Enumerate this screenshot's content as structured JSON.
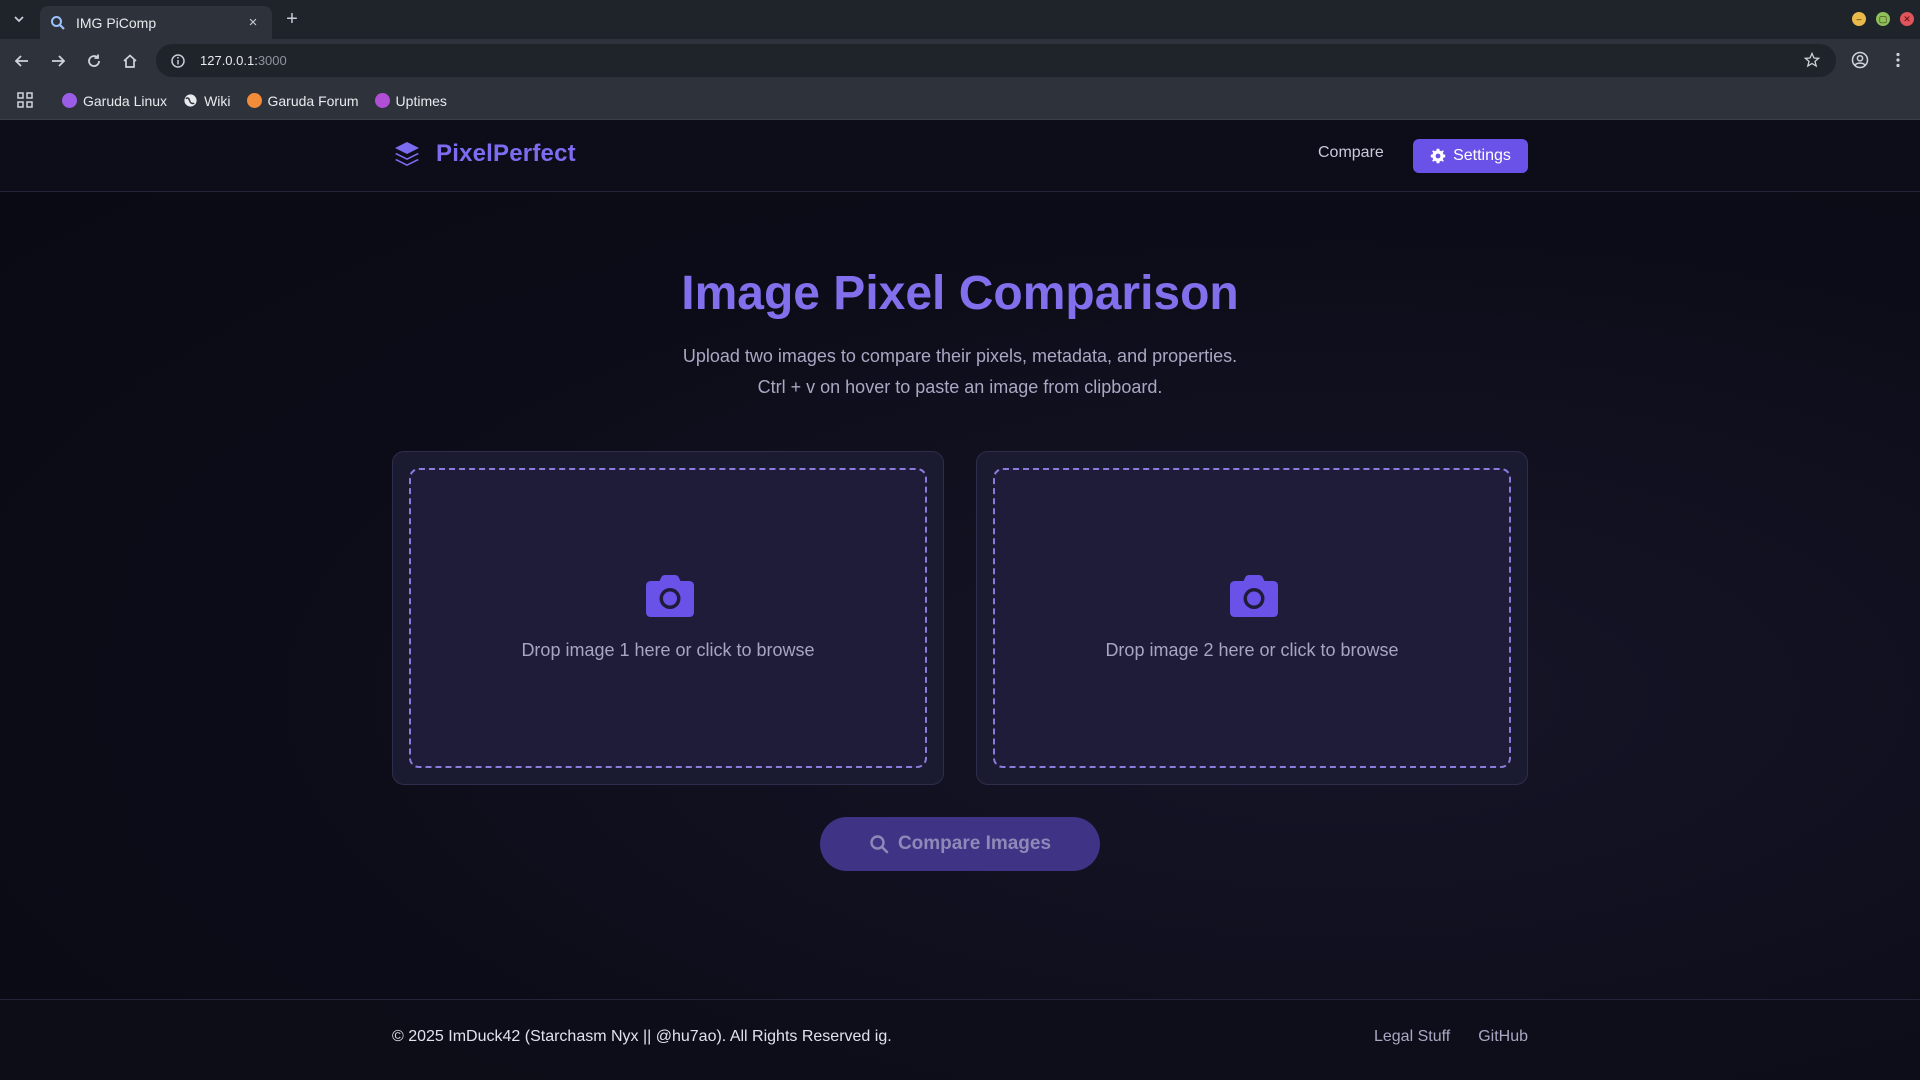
{
  "browser": {
    "tab": {
      "title": "IMG PiComp",
      "favicon": "search-icon",
      "close": "×"
    },
    "new_tab": "+",
    "url_host": "127.0.0.1:",
    "url_port": "3000",
    "bookmarks": [
      {
        "label": "Garuda Linux",
        "icon": "garuda-icon",
        "color": "#9b5de5"
      },
      {
        "label": "Wiki",
        "icon": "globe-icon",
        "color": "#d0d3d9"
      },
      {
        "label": "Garuda Forum",
        "icon": "garuda-forum-icon",
        "color": "#f28c38"
      },
      {
        "label": "Uptimes",
        "icon": "uptime-icon",
        "color": "#b04fd6"
      }
    ]
  },
  "header": {
    "brand": "PixelPerfect",
    "nav_compare": "Compare",
    "nav_settings": "Settings"
  },
  "hero": {
    "title": "Image Pixel Comparison",
    "subtitle_1": "Upload two images to compare their pixels, metadata, and properties.",
    "subtitle_2": "Ctrl + v on hover to paste an image from clipboard."
  },
  "dropzones": [
    {
      "text": "Drop image 1 here or click to browse"
    },
    {
      "text": "Drop image 2 here or click to browse"
    }
  ],
  "compare_button": "Compare Images",
  "footer": {
    "copyright": "© 2025 ImDuck42 (Starchasm Nyx || @hu7ao). All Rights Reserved ig.",
    "links": [
      "Legal Stuff",
      "GitHub"
    ]
  },
  "colors": {
    "accent": "#6a52e8",
    "brand_text": "#7b6cf0",
    "title_text": "#8070ec",
    "page_bg": "#0c0c18"
  }
}
